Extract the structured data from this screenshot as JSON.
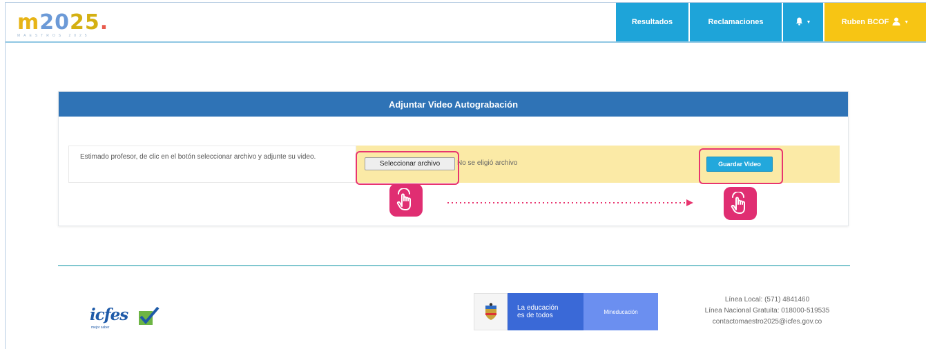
{
  "header": {
    "logo": {
      "m": "m",
      "twenty": "20",
      "twentyfive": "25",
      "dot": ".",
      "subtitle": "MAESTROS 2025"
    },
    "nav": {
      "results": "Resultados",
      "claims": "Reclamaciones",
      "user": "Ruben BCOF"
    },
    "colors": {
      "nav_blue": "#1ea4d9",
      "nav_yellow": "#f7c514"
    }
  },
  "panel": {
    "title": "Adjuntar Video Autograbación",
    "instructions": "Estimado profesor, de clic en el botón seleccionar archivo y adjunte su video.",
    "file_button": "Seleccionar archivo",
    "file_status": "No se eligió archivo",
    "save_button": "Guardar Video",
    "colors": {
      "header": "#2f73b6",
      "upload_bg": "#fbeaa6",
      "highlight": "#e8356f"
    }
  },
  "footer": {
    "icfes": {
      "word": "icfes",
      "tagline": "mejor saber"
    },
    "gov": {
      "edu_line1": "La educación",
      "edu_line2": "es de todos",
      "ministry": "Mineducación"
    },
    "contact": {
      "local": "Línea Local: (571) 4841460",
      "national": "Línea Nacional Gratuita: 018000-519535",
      "email": "contactomaestro2025@icfes.gov.co"
    }
  }
}
